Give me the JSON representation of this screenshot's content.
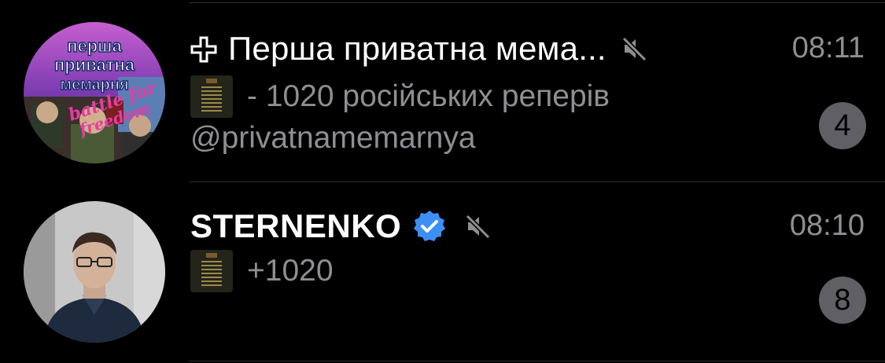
{
  "chats": [
    {
      "title": "Перша приватна мема...",
      "time": "08:11",
      "message": "- 1020 російських реперів",
      "message_line2": "@privatnamemarnya",
      "unread": "4",
      "avatar_text": [
        "перша",
        "приватна",
        "мемарня",
        "battle for",
        "freedom"
      ],
      "icons": [
        "cross-icon",
        "muted-icon",
        "media-thumbnail"
      ]
    },
    {
      "title": "STERNENKO",
      "time": "08:10",
      "message": "+1020",
      "unread": "8",
      "icons": [
        "verified-icon",
        "muted-icon",
        "media-thumbnail"
      ]
    }
  ],
  "colors": {
    "background": "#000000",
    "secondary_text": "#8e8e93",
    "verified_badge": "#3d8ff5",
    "unread_badge": "#5f5f64",
    "divider": "#2c2c2e"
  }
}
